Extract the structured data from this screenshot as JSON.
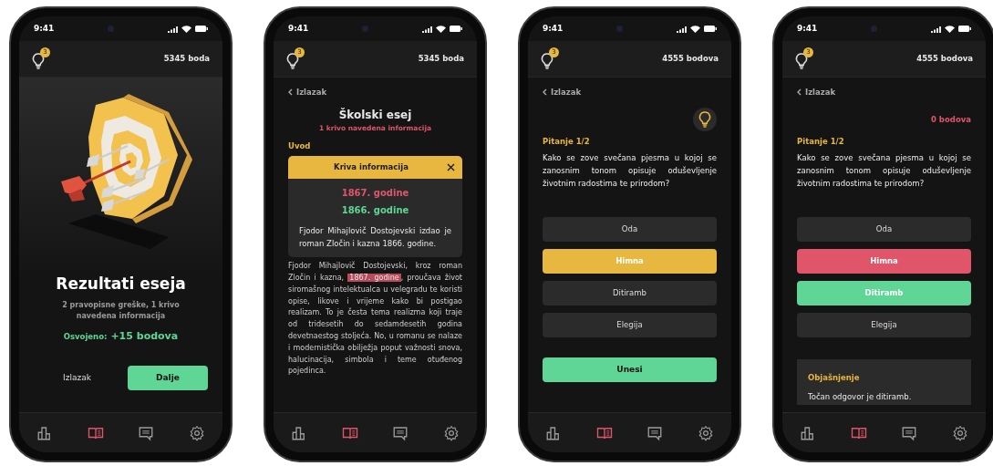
{
  "phones": [
    {
      "status_time": "9:41",
      "hint_count": "3",
      "points": "5345 boda",
      "screen": {
        "kind": "result",
        "title": "Rezultati eseja",
        "summary": "2 pravopisne greške, 1 krivo navedena informacija",
        "earned_label": "Osvojeno:",
        "earned_value": "+15 bodova",
        "exit_button": "Izlazak",
        "next_button": "Dalje"
      },
      "nav": [
        {
          "selected": false
        },
        {
          "selected": true
        },
        {
          "selected": false
        },
        {
          "selected": false
        }
      ]
    },
    {
      "status_time": "9:41",
      "hint_count": "3",
      "points": "5345 boda",
      "screen": {
        "kind": "essay",
        "back": "Izlazak",
        "title": "Školski esej",
        "subtitle": "1 krivo navedena informacija",
        "section": "Uvod",
        "popup": {
          "title": "Kriva informacija",
          "wrong": "1867. godine",
          "correct": "1866. godine",
          "explanation": "Fjodor Mihajlovič Dostojevski izdao je roman Zločin i kazna 1866. godine."
        },
        "body": [
          {
            "text": "Fjodor Mihajlovič Dostojevski, kroz roman Zločin i kazna, ",
            "highlighted": false
          },
          {
            "text": "1867. godine",
            "highlighted": true
          },
          {
            "text": ", proučava život siromašnog intelektualca u velegradu te koristi opise, likove i vrijeme kako bi postigao realizam. To je česta tema realizma koji traje od tridesetih do sedamdesetih godina devetnaestog stoljeća. No, u romanu se nalaze i modernistička obilježja poput važnosti snova, halucinacija, simbola i teme otuđenog pojedinca.",
            "highlighted": false
          }
        ]
      },
      "nav": [
        {
          "selected": false
        },
        {
          "selected": true
        },
        {
          "selected": false
        },
        {
          "selected": false
        }
      ]
    },
    {
      "status_time": "9:41",
      "hint_count": "3",
      "points": "4555 bodova",
      "screen": {
        "kind": "quiz",
        "back": "Izlazak",
        "hint_available": true,
        "question_label": "Pitanje 1/2",
        "question": "Kako se zove svečana pjesma u kojoj se zanosnim tonom opisuje oduševljenje životnim radostima te prirodom?",
        "answers": [
          {
            "text": "Oda",
            "selected": false
          },
          {
            "text": "Himna",
            "selected": true
          },
          {
            "text": "Ditiramb",
            "selected": false
          },
          {
            "text": "Elegija",
            "selected": false
          }
        ],
        "submit_button": "Unesi"
      },
      "nav": [
        {
          "selected": false
        },
        {
          "selected": true
        },
        {
          "selected": false
        },
        {
          "selected": false
        }
      ]
    },
    {
      "status_time": "9:41",
      "hint_count": "3",
      "points": "4555 bodova",
      "screen": {
        "kind": "quiz",
        "back": "Izlazak",
        "score": "0 bodova",
        "question_label": "Pitanje 1/2",
        "question": "Kako se zove svečana pjesma u kojoj se zanosnim tonom opisuje oduševljenje životnim radostima te prirodom?",
        "answers": [
          {
            "text": "Oda",
            "kind": "neutral"
          },
          {
            "text": "Himna",
            "kind": "wrong"
          },
          {
            "text": "Ditiramb",
            "kind": "correct"
          },
          {
            "text": "Elegija",
            "kind": "neutral"
          }
        ],
        "explanation": {
          "title": "Objašnjenje",
          "text": "Točan odgovor je ditiramb."
        }
      },
      "nav": [
        {
          "selected": false
        },
        {
          "selected": true
        },
        {
          "selected": false
        },
        {
          "selected": false
        }
      ]
    }
  ]
}
